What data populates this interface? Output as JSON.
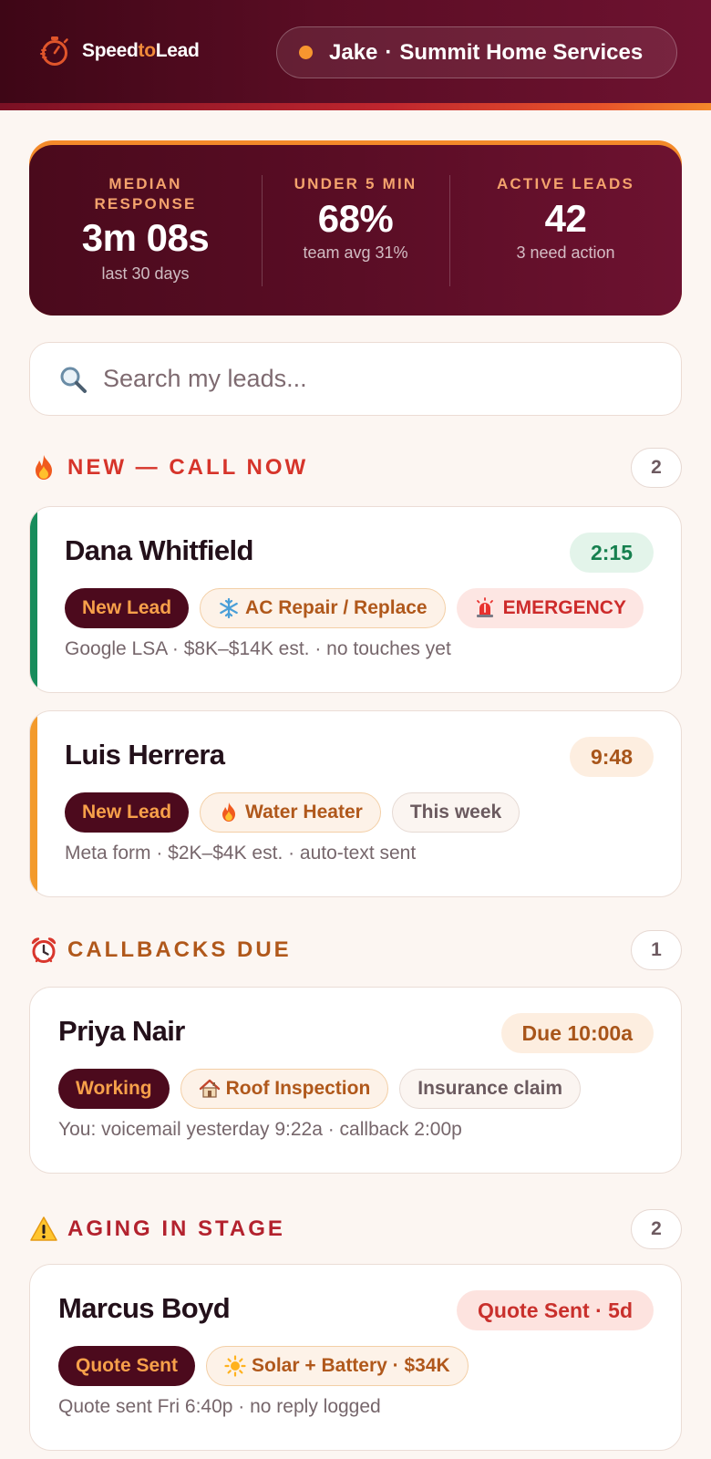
{
  "header": {
    "logo_prefix": "Speed",
    "logo_mid": "to",
    "logo_suffix": "Lead",
    "user_name": "Jake",
    "user_sep": "·",
    "user_company": "Summit Home Services"
  },
  "stats": [
    {
      "label": "MEDIAN RESPONSE",
      "value": "3m 08s",
      "sub": "last 30 days"
    },
    {
      "label": "UNDER 5 MIN",
      "value": "68%",
      "sub": "team avg 31%"
    },
    {
      "label": "ACTIVE LEADS",
      "value": "42",
      "sub": "3 need action"
    }
  ],
  "search": {
    "placeholder": "Search my leads..."
  },
  "sections": {
    "new": {
      "title": "NEW — CALL NOW",
      "count": "2",
      "icon": "fire-icon",
      "color": "#d6342a"
    },
    "callbacks": {
      "title": "CALLBACKS DUE",
      "count": "1",
      "icon": "alarm-clock-icon",
      "color": "#b0581b"
    },
    "aging": {
      "title": "AGING IN STAGE",
      "count": "2",
      "icon": "warning-icon",
      "color": "#b3222e"
    }
  },
  "leads": [
    {
      "name": "Dana Whitfield",
      "timer": "2:15",
      "stage": "New Lead",
      "service": "AC Repair / Replace",
      "service_icon": "snowflake-icon",
      "extra": "EMERGENCY",
      "extra_icon": "siren-icon",
      "meta": "Google LSA · $8K–$14K est. · no touches yet"
    },
    {
      "name": "Luis Herrera",
      "timer": "9:48",
      "stage": "New Lead",
      "service": "Water Heater",
      "service_icon": "fire-icon",
      "extra": "This week",
      "meta": "Meta form · $2K–$4K est. · auto-text sent"
    },
    {
      "name": "Priya Nair",
      "timer": "Due 10:00a",
      "stage": "Working",
      "service": "Roof Inspection",
      "service_icon": "house-icon",
      "extra": "Insurance claim",
      "meta": "You: voicemail yesterday 9:22a · callback 2:00p"
    },
    {
      "name": "Marcus Boyd",
      "timer": "Quote Sent · 5d",
      "stage": "Quote Sent",
      "service": "Solar + Battery · $34K",
      "service_icon": "sun-icon",
      "meta": "Quote sent Fri 6:40p · no reply logged"
    }
  ],
  "colors": {
    "brand_dark": "#4c0a1d",
    "accent_orange": "#f39a2b",
    "accent_green": "#178c5b",
    "urgent_red": "#cd2b2b"
  }
}
